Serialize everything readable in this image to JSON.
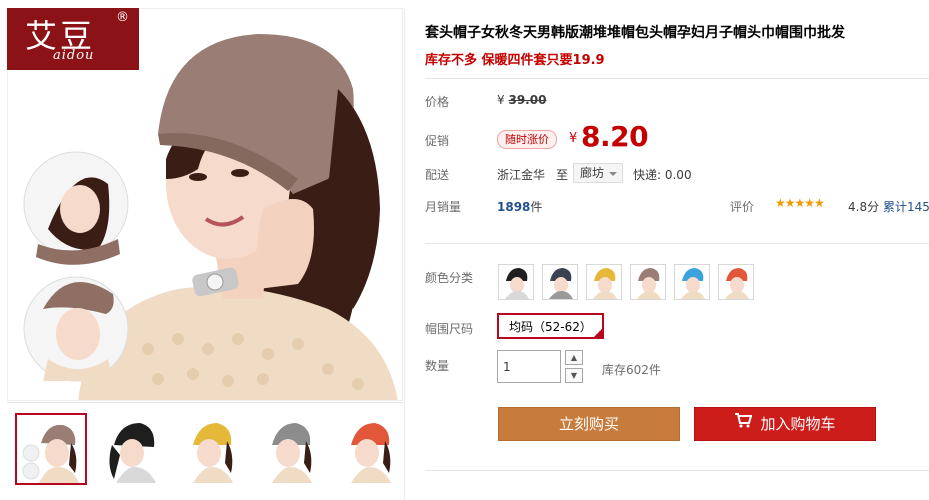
{
  "brand": {
    "cn": "艾豆",
    "en": "aidou",
    "reg": "®"
  },
  "product": {
    "title": "套头帽子女秋冬天男韩版潮堆堆帽包头帽孕妇月子帽头巾帽围巾批发",
    "subtitle": "库存不多 保暖四件套只要19.9"
  },
  "price": {
    "label": "价格",
    "currency": "¥",
    "original": "39.00"
  },
  "promo": {
    "label": "促销",
    "tag": "随时涨价",
    "currency": "¥",
    "price": "8.20"
  },
  "shipping": {
    "label": "配送",
    "origin": "浙江金华",
    "to": "至",
    "destination": "廊坊",
    "fee": "快递: 0.00"
  },
  "sales": {
    "label": "月销量",
    "count": "1898",
    "unit": "件"
  },
  "rating": {
    "label": "评价",
    "stars_display": "★★★★★",
    "stars": 5,
    "score": "4.8分",
    "total": "累计145"
  },
  "color": {
    "label": "颜色分类",
    "swatches": [
      "black",
      "navy",
      "yellow",
      "taupe",
      "blue",
      "orange-red"
    ]
  },
  "size": {
    "label": "帽围尺码",
    "selected": "均码（52-62）"
  },
  "quantity": {
    "label": "数量",
    "value": "1",
    "stock": "库存602件"
  },
  "actions": {
    "buy": "立刻购买",
    "cart": "加入购物车"
  },
  "colors": {
    "accent": "#c40000",
    "buy_button": "#c77c3d",
    "cart_button": "#cd1d1b",
    "logo_bg": "#8b1216",
    "hat_main": "#9a7d74"
  }
}
